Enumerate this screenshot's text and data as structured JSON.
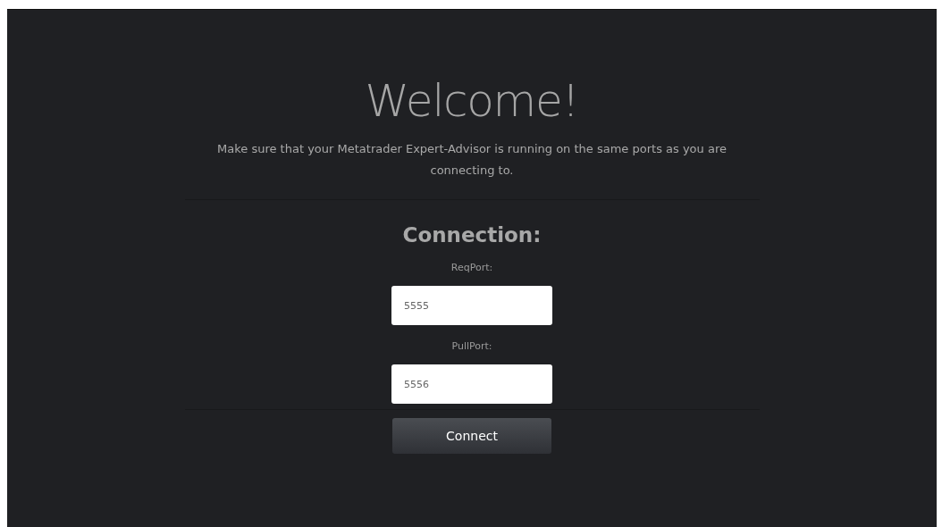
{
  "heading": "Welcome!",
  "intro": "Make sure that your Metatrader Expert-Advisor is running on the same ports as you are connecting to.",
  "section_title": "Connection:",
  "fields": [
    {
      "label": "ReqPort:",
      "value": "5555"
    },
    {
      "label": "PullPort:",
      "value": "5556"
    }
  ],
  "button": "Connect"
}
